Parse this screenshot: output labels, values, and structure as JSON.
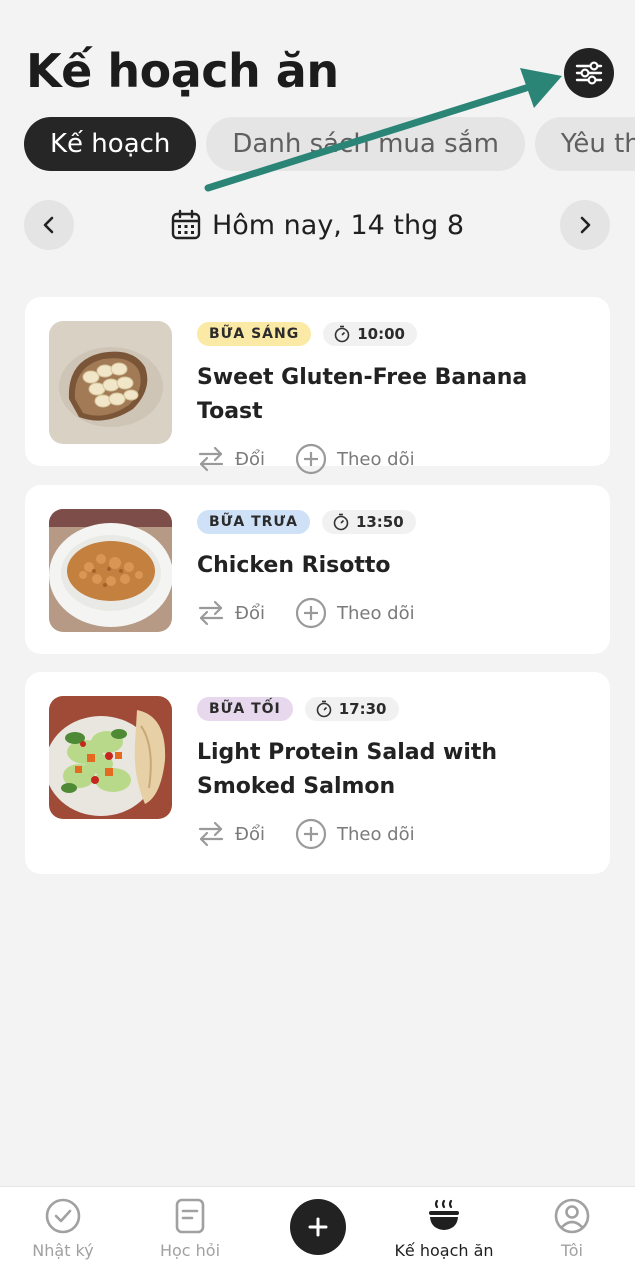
{
  "header": {
    "title": "Kế hoạch ăn",
    "filter_icon": "sliders-icon"
  },
  "tabs": [
    {
      "label": "Kế hoạch",
      "active": true
    },
    {
      "label": "Danh sách mua sắm",
      "active": false
    },
    {
      "label": "Yêu thí",
      "active": false
    }
  ],
  "date_nav": {
    "label": "Hôm nay, 14 thg 8",
    "icon": "calendar-icon"
  },
  "meals": [
    {
      "tag": "BỮA SÁNG",
      "tag_color": "#fbe9a6",
      "time": "10:00",
      "name": "Sweet Gluten-Free Banana Toast",
      "swap_label": "Đổi",
      "track_label": "Theo dõi"
    },
    {
      "tag": "BỮA TRƯA",
      "tag_color": "#cfe1f7",
      "time": "13:50",
      "name": "Chicken Risotto",
      "swap_label": "Đổi",
      "track_label": "Theo dõi"
    },
    {
      "tag": "BỮA TỐI",
      "tag_color": "#e7d8ee",
      "time": "17:30",
      "name": "Light Protein Salad with Smoked Salmon",
      "swap_label": "Đổi",
      "track_label": "Theo dõi"
    }
  ],
  "bottom_nav": {
    "items": [
      {
        "label": "Nhật ký",
        "icon": "check-circle-icon"
      },
      {
        "label": "Học hỏi",
        "icon": "document-icon"
      },
      {
        "label": "Kế hoạch ăn",
        "icon": "bowl-icon",
        "active": true
      },
      {
        "label": "Tôi",
        "icon": "profile-icon"
      }
    ],
    "add_icon": "plus-icon"
  },
  "colors": {
    "accent_dark": "#222222",
    "annotation_arrow": "#2a8577"
  }
}
